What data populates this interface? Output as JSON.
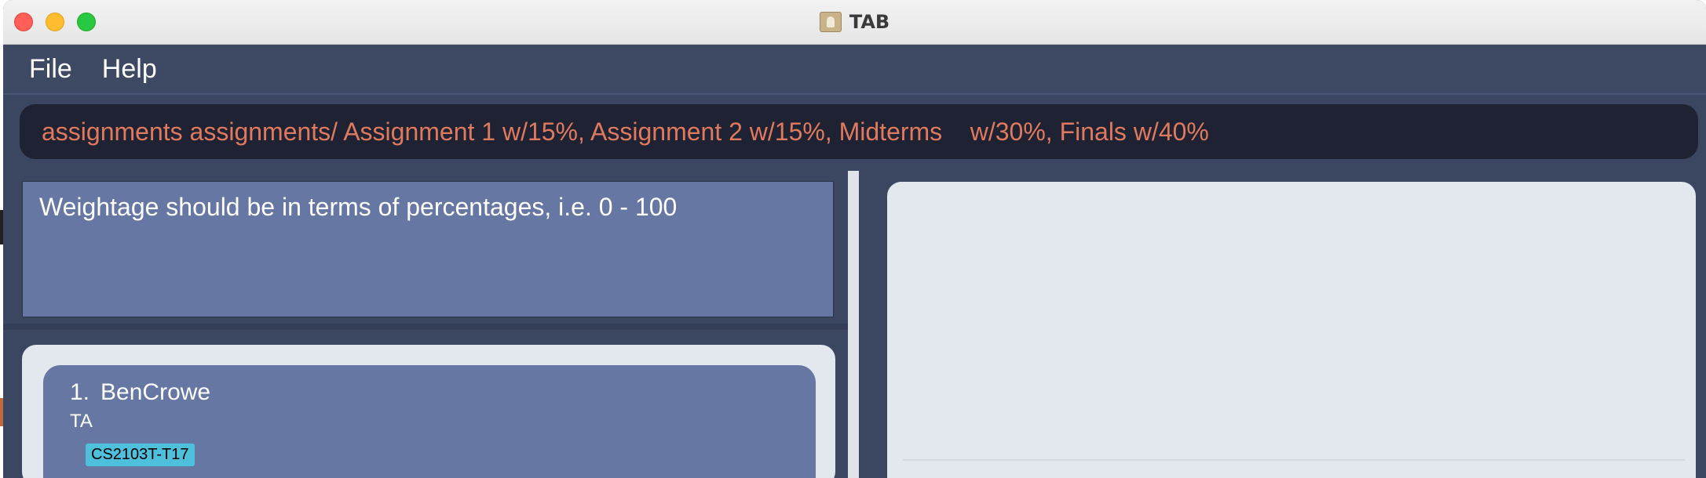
{
  "window": {
    "title": "TAB",
    "app_icon": "address-book-icon"
  },
  "menu": {
    "items": [
      {
        "label": "File"
      },
      {
        "label": "Help"
      }
    ]
  },
  "command": {
    "value": "assignments assignments/ Assignment 1 w/15%, Assignment 2 w/15%, Midterms    w/30%, Finals w/40%"
  },
  "result": {
    "message": "Weightage should be in terms of percentages, i.e. 0 - 100"
  },
  "persons": [
    {
      "index": "1.",
      "name": "BenCrowe",
      "role": "TA",
      "tags": [
        "CS2103T-T17"
      ]
    }
  ],
  "colors": {
    "background": "#3b4760",
    "command_text": "#e07a5f",
    "card": "#6677a3",
    "tag": "#4fc0dc"
  }
}
